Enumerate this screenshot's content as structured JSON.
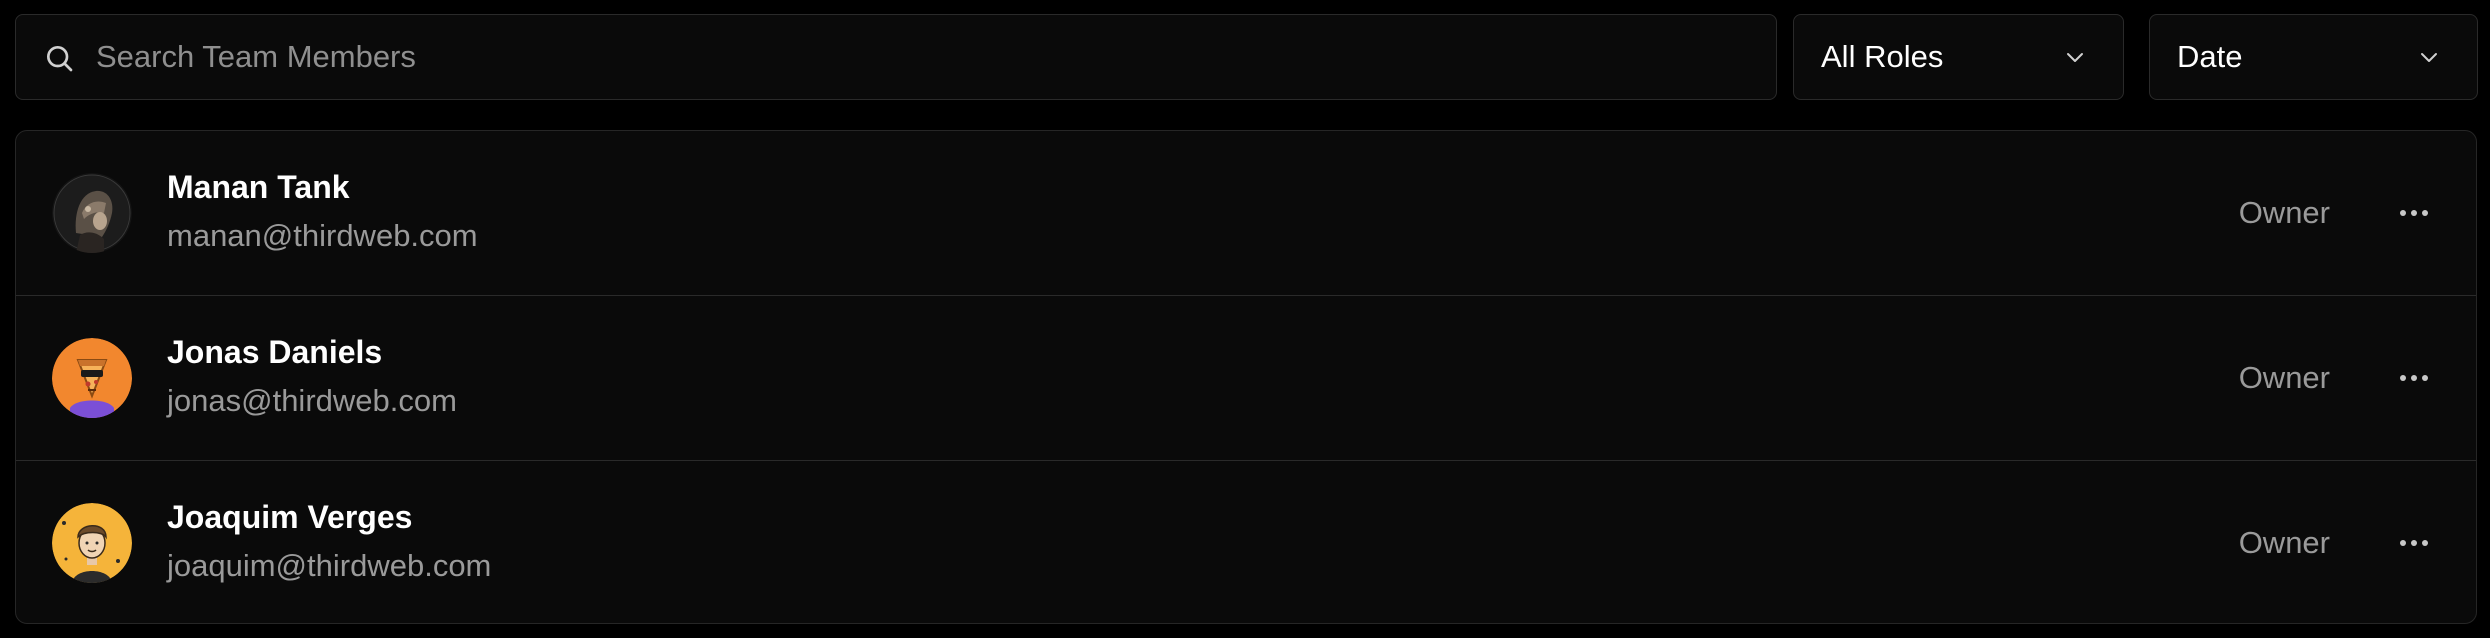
{
  "filters": {
    "search_placeholder": "Search Team Members",
    "search_value": "",
    "role_select_value": "All Roles",
    "sort_select_value": "Date"
  },
  "icons": {
    "search": "search-icon",
    "dropdown": "chevron-down-icon",
    "more": "more-horizontal-icon"
  },
  "colors": {
    "background": "#000000",
    "card": "#0a0a0a",
    "border": "#2a2a2a",
    "text_primary": "#ffffff",
    "text_secondary": "#9a9a9a"
  },
  "members": [
    {
      "name": "Manan Tank",
      "email": "manan@thirdweb.com",
      "role": "Owner",
      "avatar": "dark-helmet-avatar"
    },
    {
      "name": "Jonas Daniels",
      "email": "jonas@thirdweb.com",
      "role": "Owner",
      "avatar": "orange-pizza-avatar"
    },
    {
      "name": "Joaquim Verges",
      "email": "joaquim@thirdweb.com",
      "role": "Owner",
      "avatar": "cartoon-man-avatar"
    }
  ]
}
